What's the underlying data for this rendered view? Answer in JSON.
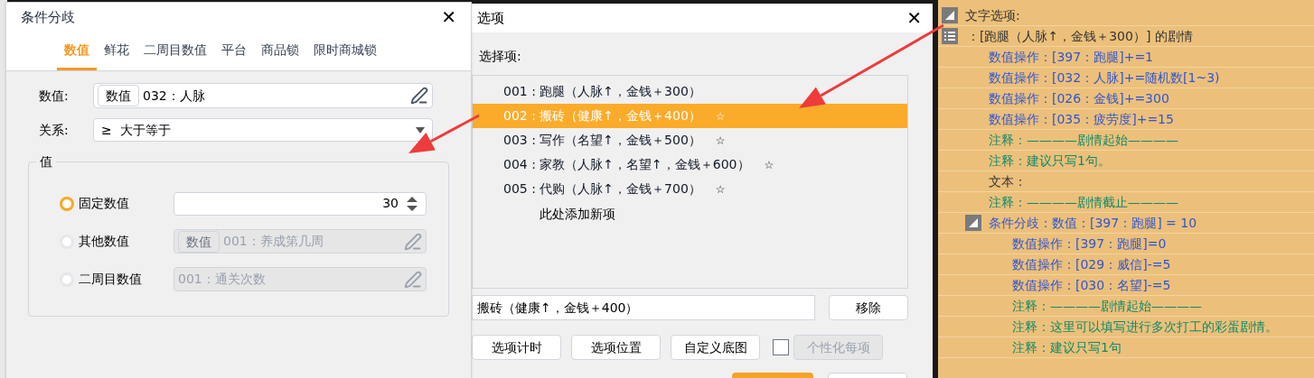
{
  "condition_dialog": {
    "title": "条件分歧",
    "close": "✕",
    "tabs": [
      {
        "label": "数值",
        "selected": true
      },
      {
        "label": "鲜花",
        "selected": false
      },
      {
        "label": "二周目数值",
        "selected": false
      },
      {
        "label": "平台",
        "selected": false
      },
      {
        "label": "商品锁",
        "selected": false
      },
      {
        "label": "限时商城锁",
        "selected": false
      }
    ],
    "value_field": {
      "label": "数值:",
      "tag": "数值",
      "value": "032：人脉"
    },
    "relation": {
      "label": "关系:",
      "value": "≥  大于等于"
    },
    "value_group": {
      "title": "值",
      "options": [
        {
          "kind": "number",
          "label": "固定数值",
          "selected": true,
          "disabled": false,
          "value": "30"
        },
        {
          "kind": "variable",
          "label": "其他数值",
          "selected": false,
          "disabled": true,
          "tag": "数值",
          "value": "001：养成第几周"
        },
        {
          "kind": "variable",
          "label": "二周目数值",
          "selected": false,
          "disabled": true,
          "value": "001：通关次数"
        }
      ]
    }
  },
  "options_dialog": {
    "title": "选项",
    "close": "✕",
    "list_label": "选择项:",
    "items": [
      {
        "label": "001 : 跑腿（人脉↑，金钱＋300）",
        "selected": false
      },
      {
        "label": "002 : 搬砖（健康↑，金钱＋400）",
        "star": "☆",
        "selected": true
      },
      {
        "label": "003 : 写作（名望↑，金钱＋500）",
        "star": "☆",
        "selected": false
      },
      {
        "label": "004 : 家教（人脉↑，名望↑，金钱＋600）",
        "star": "☆",
        "selected": false
      },
      {
        "label": "005 : 代购（人脉↑，金钱＋700）",
        "star": "☆",
        "selected": false
      }
    ],
    "add_item": "此处添加新项",
    "edit_value": "搬砖（健康↑，金钱＋400）",
    "remove_button": "移除",
    "buttons": [
      "选项计时",
      "选项位置",
      "自定义底图"
    ],
    "personalize": {
      "label": "个性化每项",
      "checked": false,
      "disabled": true
    }
  },
  "event_tree": [
    {
      "kind": "group",
      "text": "文字选项:",
      "expanded": true,
      "children": [
        {
          "kind": "option",
          "text": "：[跑腿（人脉↑，金钱＋300）] 的剧情",
          "children": [
            {
              "kind": "op",
              "text": "数值操作：[397：跑腿]+=1"
            },
            {
              "kind": "op",
              "text": "数值操作：[032：人脉]+=随机数[1~3)"
            },
            {
              "kind": "op",
              "text": "数值操作：[026：金钱]+=300"
            },
            {
              "kind": "op",
              "text": "数值操作：[035：疲劳度]+=15"
            },
            {
              "kind": "comment",
              "text": "注释：————剧情起始————"
            },
            {
              "kind": "comment",
              "text": "注释：建议只写1句。"
            },
            {
              "kind": "text",
              "text": "文本："
            },
            {
              "kind": "comment",
              "text": "注释：————剧情截止————"
            },
            {
              "kind": "branch",
              "text": "条件分歧：数值：[397：跑腿] = 10",
              "expanded": true,
              "children": [
                {
                  "kind": "op",
                  "text": "数值操作：[397：跑腿]=0"
                },
                {
                  "kind": "op",
                  "text": "数值操作：[029：威信]-=5"
                },
                {
                  "kind": "op",
                  "text": "数值操作：[030：名望]-=5"
                },
                {
                  "kind": "comment",
                  "text": "注释：————剧情起始————"
                },
                {
                  "kind": "comment",
                  "text": "注释：这里可以填写进行多次打工的彩蛋剧情。"
                },
                {
                  "kind": "comment",
                  "text": "注释：建议只写1句"
                }
              ]
            }
          ]
        }
      ]
    }
  ]
}
